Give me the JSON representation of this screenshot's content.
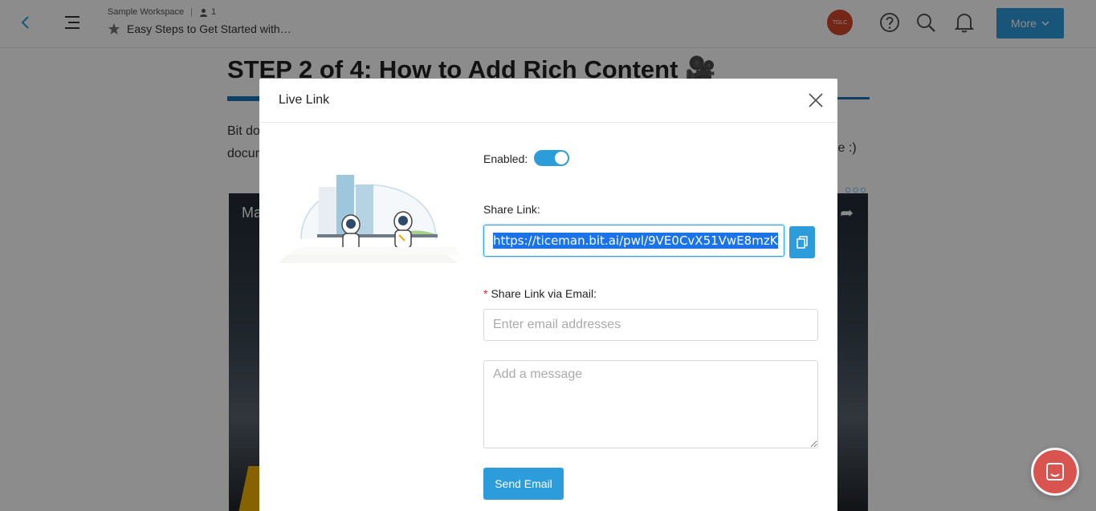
{
  "topbar": {
    "workspace": "Sample Workspace",
    "member_count": "1",
    "doc_title": "Easy Steps to Get Started with…",
    "avatar_initials": "TDLC",
    "more_label": "More",
    "icons": [
      "back-arrow-icon",
      "menu-icon",
      "user-icon",
      "star-icon",
      "help-icon",
      "search-icon",
      "bell-icon",
      "chevron-down-icon"
    ]
  },
  "document": {
    "heading": "STEP 2 of 4: How to Add Rich Content 🎥",
    "paragraph_start": "Bit do",
    "paragraph_line2_start": "docum",
    "paragraph_tail": "le :)",
    "video_title": "Ma"
  },
  "modal": {
    "title": "Live Link",
    "enabled_label": "Enabled",
    "enabled": true,
    "share_link_label": "Share Link",
    "share_link_value": "https://ticeman.bit.ai/pwl/9VE0CvX51VwE8mzK",
    "email_label": "Share Link via Email",
    "email_placeholder": "Enter email addresses",
    "message_placeholder": "Add a message",
    "send_label": "Send Email"
  },
  "colors": {
    "accent": "#2d9cdb",
    "avatar": "#d4452b",
    "required": "#f5222d"
  }
}
